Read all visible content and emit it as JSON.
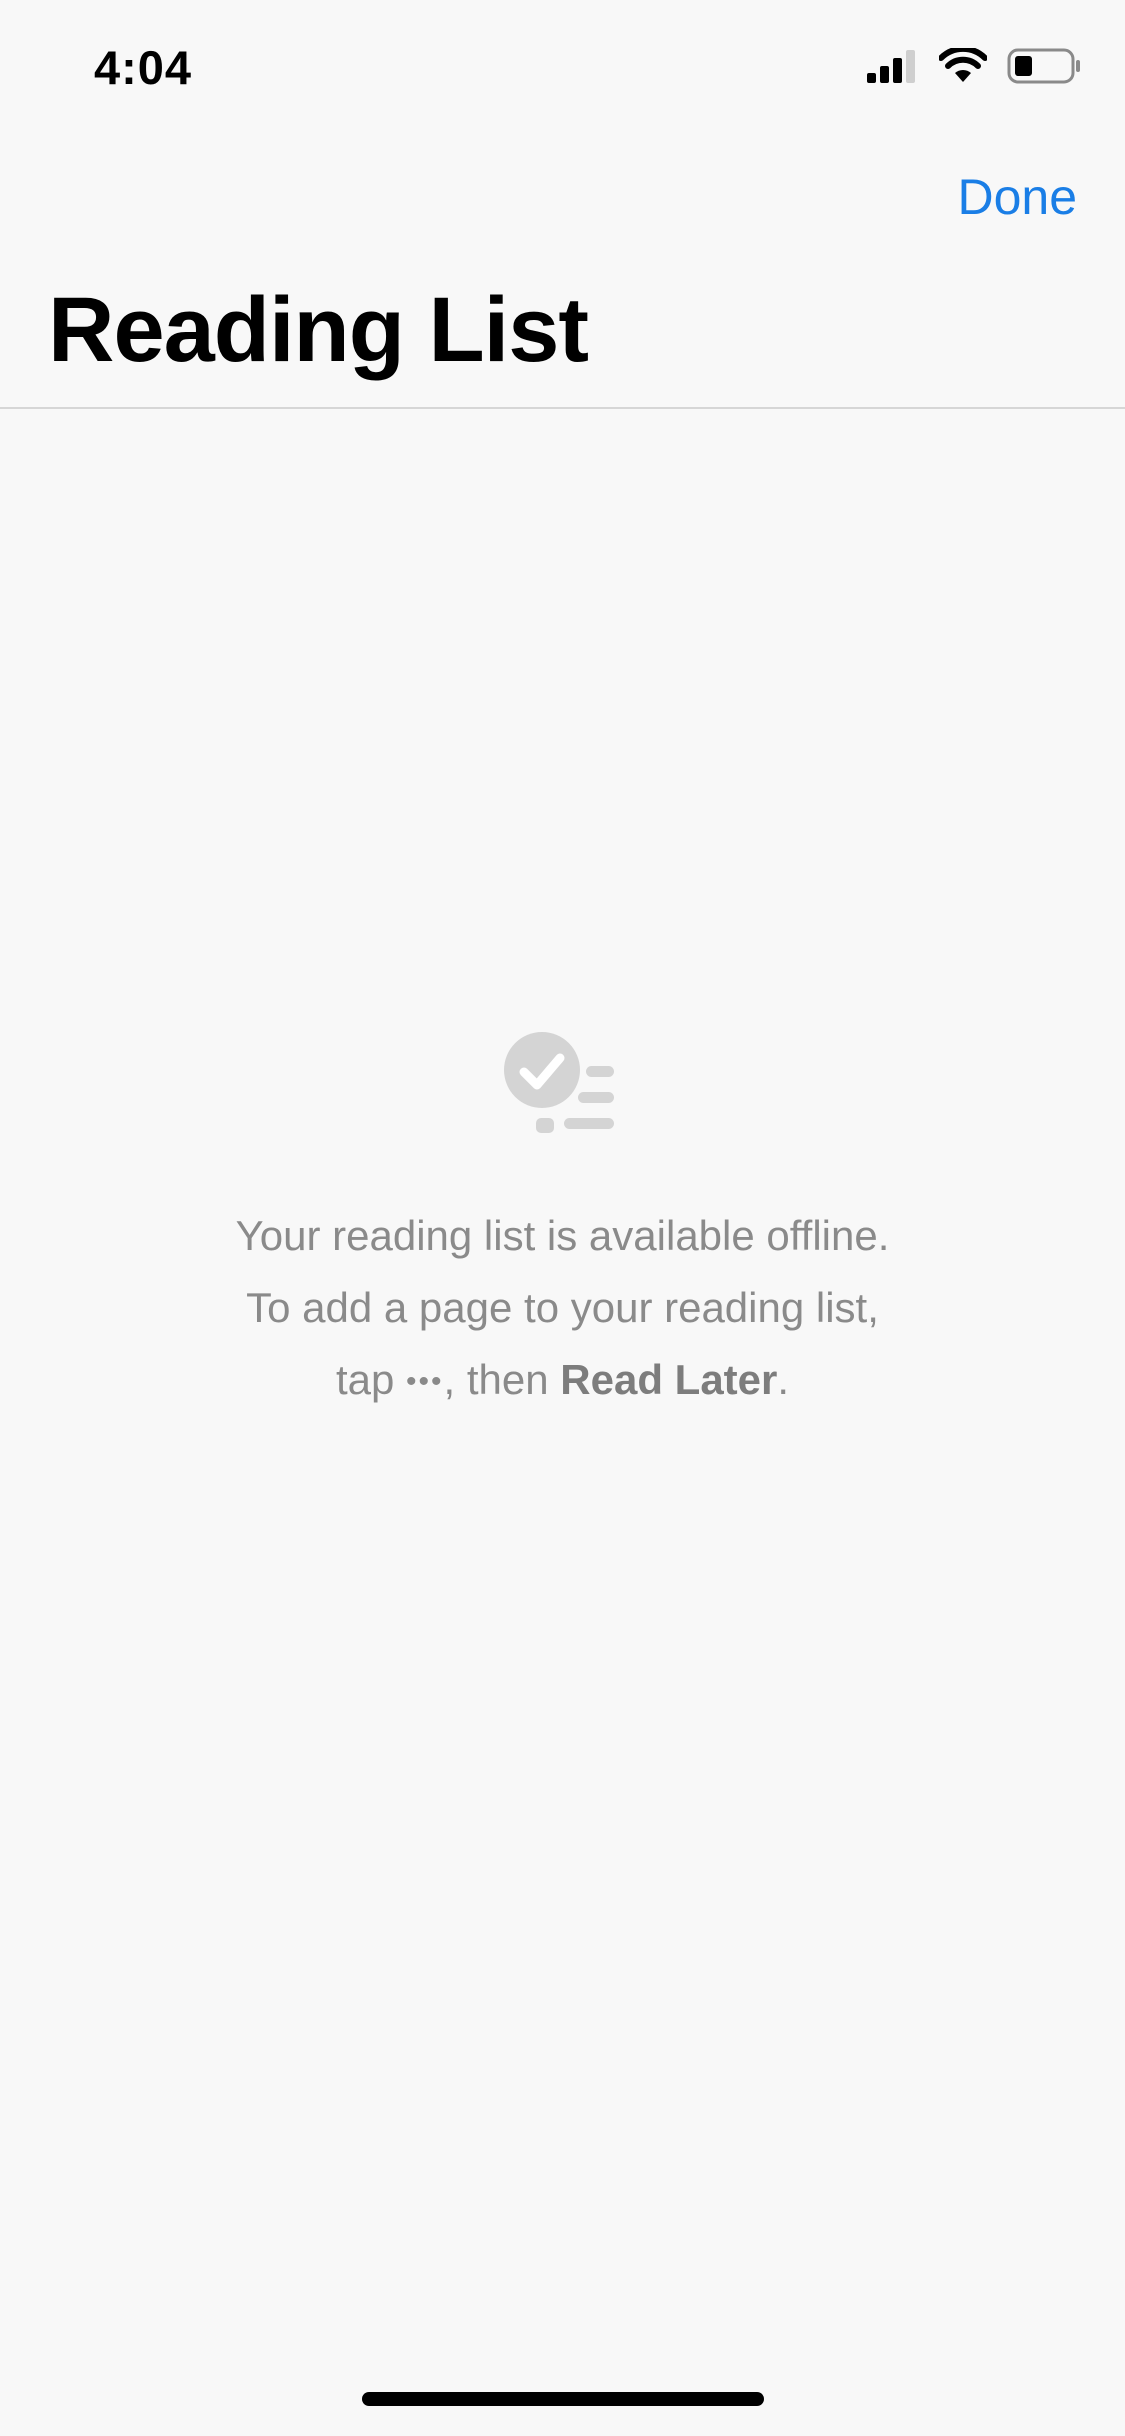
{
  "status_bar": {
    "time": "4:04",
    "icons": [
      "cellular-signal-icon",
      "wifi-icon",
      "battery-icon"
    ]
  },
  "nav": {
    "done_label": "Done",
    "title": "Reading List"
  },
  "empty_state": {
    "icon": "reading-list-icon",
    "line1": "Your reading list is available offline.",
    "line2": "To add a page to your reading list,",
    "line3_prefix": "tap ",
    "line3_glyph": "•••",
    "line3_mid": ", then ",
    "line3_bold": "Read Later",
    "line3_suffix": "."
  },
  "colors": {
    "accent": "#1a7ee6",
    "background": "#f8f8f8",
    "secondary_text": "#8a8a8a",
    "icon_gray": "#d4d4d4"
  }
}
